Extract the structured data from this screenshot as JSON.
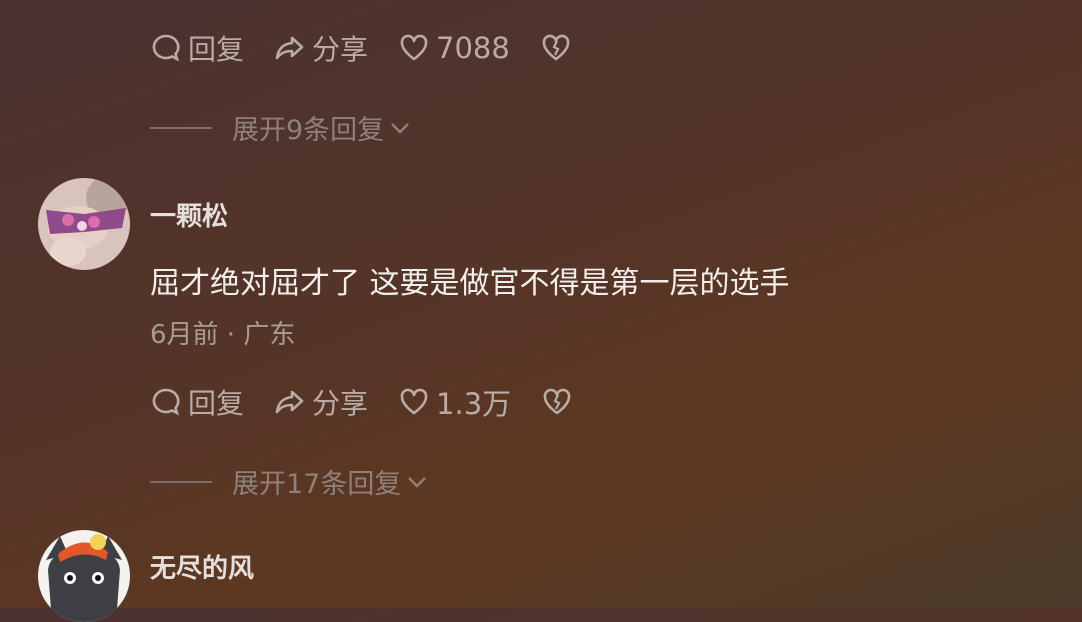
{
  "comments": [
    {
      "actions": {
        "reply": "回复",
        "share": "分享",
        "likes": "7088"
      },
      "expand": "展开9条回复"
    },
    {
      "username": "一颗松",
      "content": "屈才绝对屈才了 这要是做官不得是第一层的选手",
      "meta": "6月前 · 广东",
      "actions": {
        "reply": "回复",
        "share": "分享",
        "likes": "1.3万"
      },
      "expand": "展开17条回复"
    },
    {
      "username": "无尽的风"
    }
  ]
}
